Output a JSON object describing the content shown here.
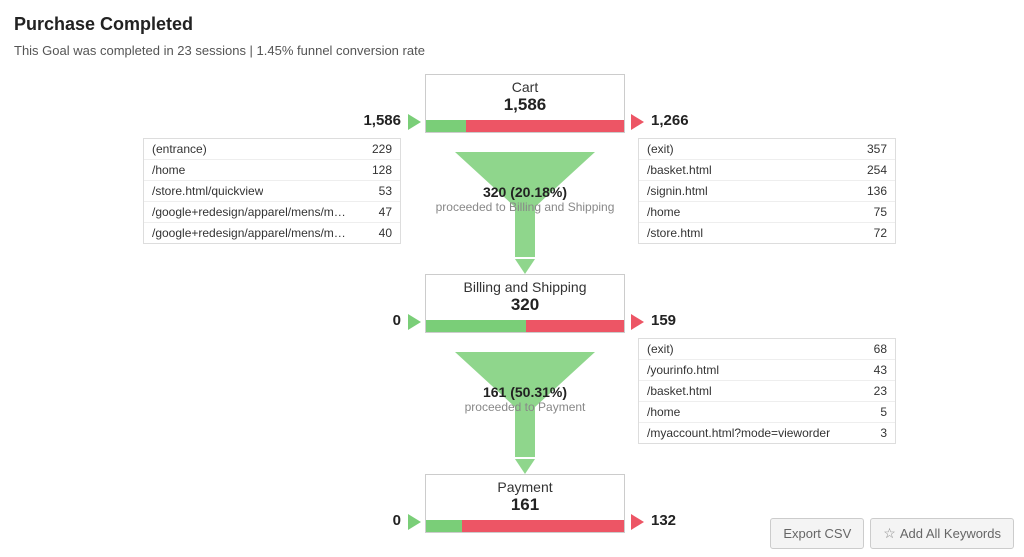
{
  "header": {
    "title": "Purchase Completed",
    "subtitle": "This Goal was completed in 23 sessions | 1.45% funnel conversion rate"
  },
  "steps": [
    {
      "name": "Cart",
      "count": "1,586",
      "in_count": "1,586",
      "out_count": "1,266",
      "green_pct": 20.18,
      "in_rows": [
        {
          "path": "(entrance)",
          "val": "229"
        },
        {
          "path": "/home",
          "val": "128"
        },
        {
          "path": "/store.html/quickview",
          "val": "53"
        },
        {
          "path": "/google+redesign/apparel/mens/mens+…",
          "val": "47"
        },
        {
          "path": "/google+redesign/apparel/mens/mens+…",
          "val": "40"
        }
      ],
      "out_rows": [
        {
          "path": "(exit)",
          "val": "357"
        },
        {
          "path": "/basket.html",
          "val": "254"
        },
        {
          "path": "/signin.html",
          "val": "136"
        },
        {
          "path": "/home",
          "val": "75"
        },
        {
          "path": "/store.html",
          "val": "72"
        }
      ],
      "flow_main": "320 (20.18%)",
      "flow_sub": "proceeded to Billing and Shipping"
    },
    {
      "name": "Billing and Shipping",
      "count": "320",
      "in_count": "0",
      "out_count": "159",
      "green_pct": 50.31,
      "in_rows": [],
      "out_rows": [
        {
          "path": "(exit)",
          "val": "68"
        },
        {
          "path": "/yourinfo.html",
          "val": "43"
        },
        {
          "path": "/basket.html",
          "val": "23"
        },
        {
          "path": "/home",
          "val": "5"
        },
        {
          "path": "/myaccount.html?mode=vieworder",
          "val": "3"
        }
      ],
      "flow_main": "161 (50.31%)",
      "flow_sub": "proceeded to Payment"
    },
    {
      "name": "Payment",
      "count": "161",
      "in_count": "0",
      "out_count": "132",
      "green_pct": 18.01,
      "in_rows": [],
      "out_rows": [],
      "flow_main": "",
      "flow_sub": ""
    }
  ],
  "buttons": {
    "export": "Export CSV",
    "add_keywords": "Add All Keywords"
  }
}
